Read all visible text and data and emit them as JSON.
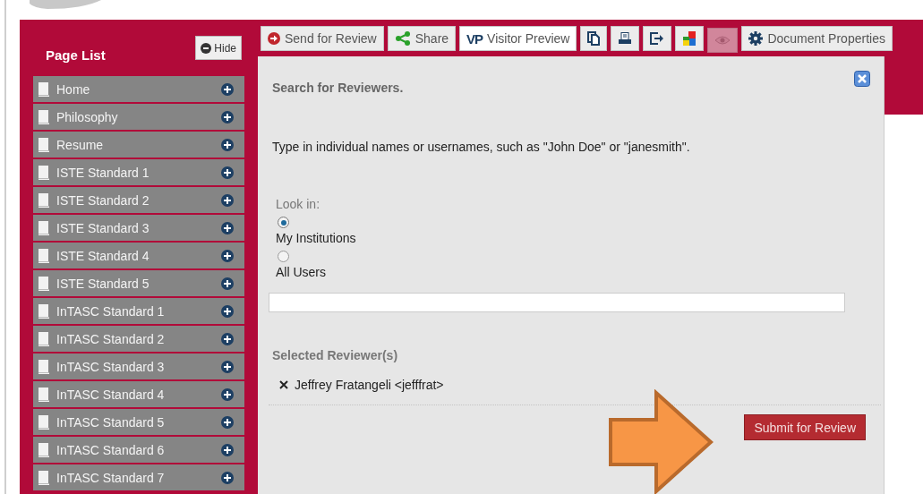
{
  "sidebar": {
    "title": "Page List",
    "hide_button": "Hide",
    "pages": [
      {
        "label": "Home"
      },
      {
        "label": "Philosophy"
      },
      {
        "label": "Resume"
      },
      {
        "label": "ISTE Standard 1"
      },
      {
        "label": "ISTE Standard 2"
      },
      {
        "label": "ISTE Standard 3"
      },
      {
        "label": "ISTE Standard 4"
      },
      {
        "label": "ISTE Standard 5"
      },
      {
        "label": "InTASC Standard 1"
      },
      {
        "label": "InTASC Standard 2"
      },
      {
        "label": "InTASC Standard 3"
      },
      {
        "label": "InTASC Standard 4"
      },
      {
        "label": "InTASC Standard 5"
      },
      {
        "label": "InTASC Standard 6"
      },
      {
        "label": "InTASC Standard 7"
      }
    ]
  },
  "toolbar": {
    "buttons": [
      {
        "kind": "send",
        "label": "Send for Review",
        "disabled": false
      },
      {
        "kind": "share",
        "label": "Share",
        "disabled": false
      },
      {
        "kind": "logo",
        "logo_text": "VP",
        "label": "Visitor Preview",
        "disabled": false
      },
      {
        "kind": "copy",
        "disabled": false
      },
      {
        "kind": "print",
        "disabled": false
      },
      {
        "kind": "export",
        "disabled": false
      },
      {
        "kind": "tiles",
        "disabled": false
      },
      {
        "kind": "eye",
        "disabled": true
      },
      {
        "kind": "gear",
        "label": "Document Properties",
        "disabled": false
      }
    ]
  },
  "dialog": {
    "title": "Search for Reviewers.",
    "instruction": "Type in individual names or usernames, such as \"John Doe\" or \"janesmith\".",
    "look_in_label": "Look in:",
    "options": [
      {
        "label": "My Institutions",
        "selected": true
      },
      {
        "label": "All Users",
        "selected": false
      }
    ],
    "selected_heading": "Selected Reviewer(s)",
    "reviewers": [
      {
        "name": "Jeffrey Fratangeli <jefffrat>"
      }
    ],
    "submit_button": "Submit for Review"
  }
}
